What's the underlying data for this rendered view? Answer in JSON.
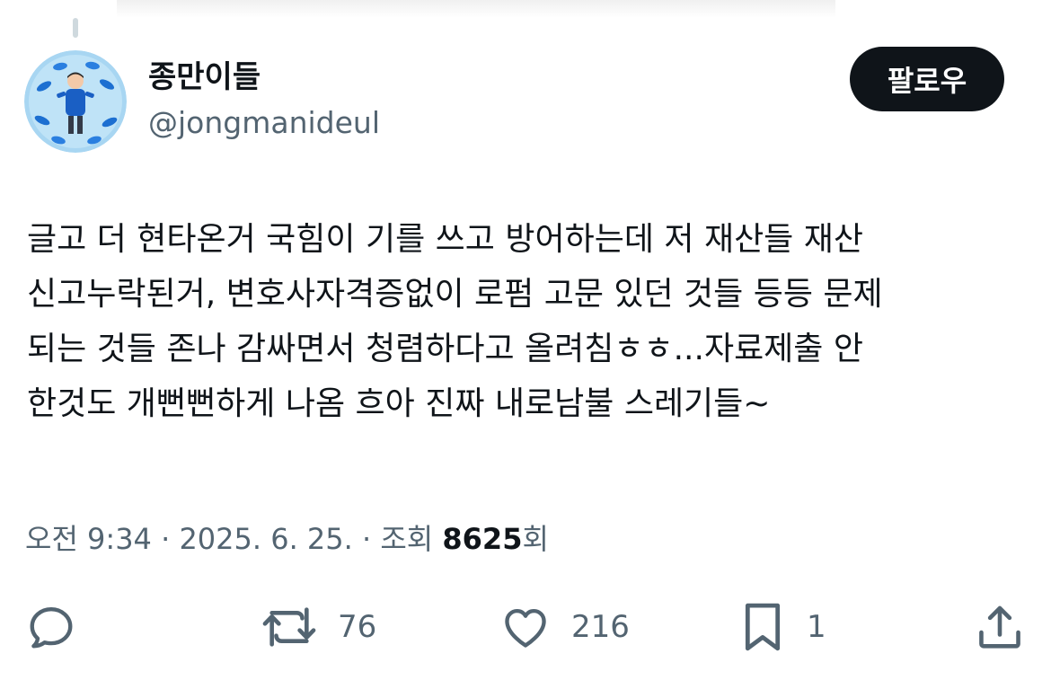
{
  "author": {
    "display_name": "종만이들",
    "handle": "@jongmanideul"
  },
  "follow_button": {
    "label": "팔로우"
  },
  "tweet": {
    "lines": [
      "글고 더 현타온거 국힘이 기를 쓰고 방어하는데 저 재산들 재산",
      "신고누락된거, 변호사자격증없이 로펌 고문 있던 것들 등등 문제",
      "되는 것들 존나 감싸면서 청렴하다고 올려침ㅎㅎ...자료제출 안",
      "한것도 개뻔뻔하게 나옴 흐아 진짜 내로남불 스레기들~"
    ]
  },
  "meta": {
    "time": "오전 9:34",
    "separator": "·",
    "date": "2025. 6. 25.",
    "views_label": "조회",
    "views_count": "8625",
    "views_suffix": "회"
  },
  "actions": {
    "reply": {
      "icon": "reply-icon",
      "count": ""
    },
    "retweet": {
      "icon": "retweet-icon",
      "count": "76"
    },
    "like": {
      "icon": "heart-icon",
      "count": "216"
    },
    "bookmark": {
      "icon": "bookmark-icon",
      "count": "1"
    },
    "share": {
      "icon": "share-icon",
      "count": ""
    }
  },
  "colors": {
    "text_primary": "#0f1419",
    "text_secondary": "#536471",
    "button_bg": "#0f1419",
    "avatar_bg": "#9fd0f0"
  }
}
